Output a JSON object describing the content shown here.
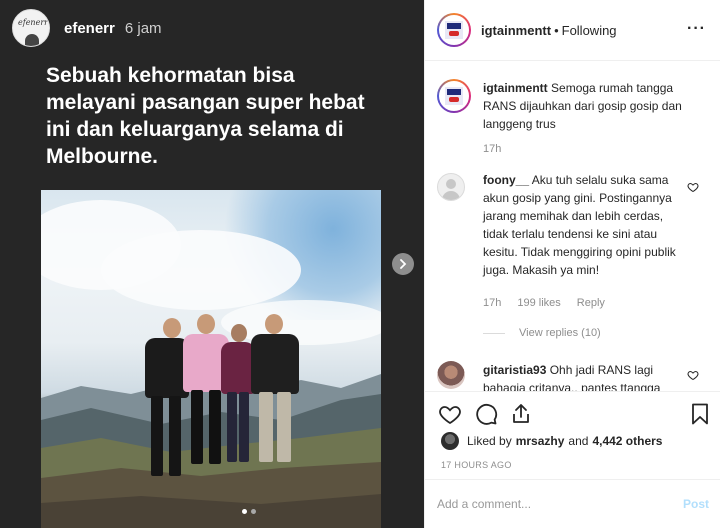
{
  "story": {
    "username": "efenerr",
    "time": "6 jam",
    "avatar_text": "efenerr",
    "caption": "Sebuah kehormatan bisa melayani pasangan super hebat ini dan keluarganya selama di Melbourne."
  },
  "post": {
    "username": "igtainmentt",
    "separator": "•",
    "follow_status": "Following"
  },
  "comments": [
    {
      "username": "igtainmentt",
      "text": "Semoga rumah tangga RANS dijauhkan dari gosip gosip dan langgeng trus",
      "time": "17h"
    },
    {
      "username": "foony__",
      "text": "Aku tuh selalu suka sama akun gosip yang gini. Postingannya jarang memihak dan lebih cerdas, tidak terlalu tendensi ke sini atau kesitu. Tidak menggiring opini publik juga. Makasih ya min!",
      "time": "17h",
      "likes": "199 likes",
      "reply": "Reply",
      "view_replies": "View replies (10)"
    },
    {
      "username": "gitaristia93",
      "text": "Ohh jadi RANS lagi bahagia critanya.. pantes ttangga"
    }
  ],
  "likes": {
    "prefix": "Liked by",
    "user": "mrsazhy",
    "conj": "and",
    "others": "4,442 others"
  },
  "timestamp": "17 HOURS AGO",
  "add_comment": {
    "placeholder": "Add a comment...",
    "post_label": "Post"
  },
  "carousel": {
    "count": 3,
    "active": 1
  },
  "colors": {
    "link_blue": "#b2dffc",
    "text": "#262626",
    "muted": "#8e8e8e"
  }
}
